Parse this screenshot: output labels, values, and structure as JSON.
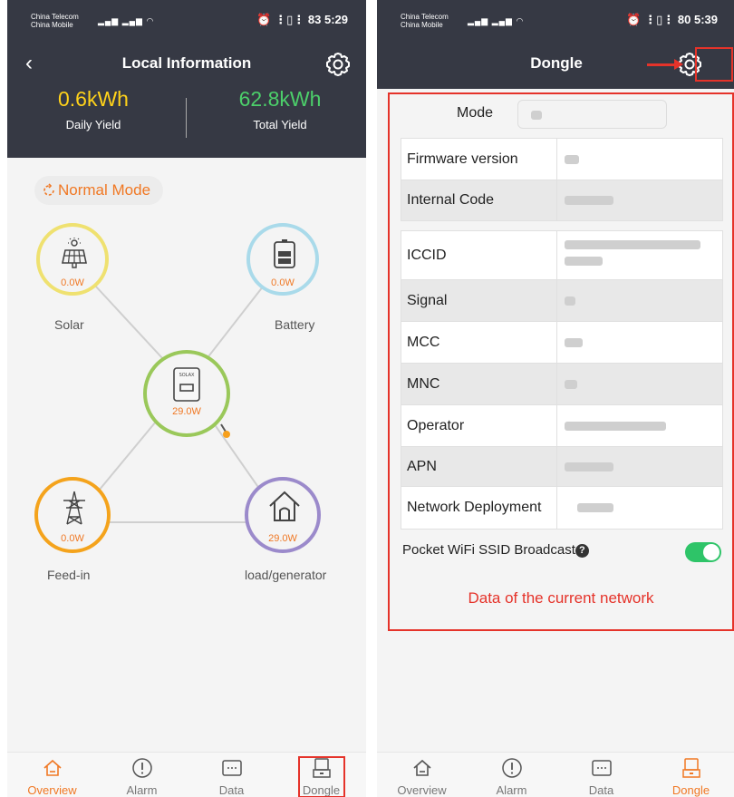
{
  "left": {
    "status": {
      "carrier1": "China Telecom",
      "carrier2": "China Mobile",
      "right": "⏰ ⋮▯⋮ 83 5:29"
    },
    "header": {
      "back": "‹",
      "title": "Local Information"
    },
    "yield": {
      "daily_value": "0.6kWh",
      "daily_label": "Daily Yield",
      "total_value": "62.8kWh",
      "total_label": "Total Yield"
    },
    "mode_label": "Normal Mode",
    "nodes": {
      "solar": {
        "power": "0.0W",
        "label": "Solar"
      },
      "battery": {
        "power": "0.0W",
        "label": "Battery"
      },
      "inverter": {
        "power": "29.0W"
      },
      "feedin": {
        "power": "0.0W",
        "label": "Feed-in"
      },
      "load": {
        "power": "29.0W",
        "label": "load/generator"
      }
    }
  },
  "right": {
    "status": {
      "carrier1": "China Telecom",
      "carrier2": "China Mobile",
      "right": "⏰ ⋮▯⋮ 80 5:39"
    },
    "header": {
      "title": "Dongle"
    },
    "mode_label": "Mode",
    "rows1": [
      {
        "label": "Firmware version"
      },
      {
        "label": "Internal Code"
      }
    ],
    "rows2": [
      {
        "label": "ICCID"
      },
      {
        "label": "Signal"
      },
      {
        "label": "MCC"
      },
      {
        "label": "MNC"
      },
      {
        "label": "Operator"
      },
      {
        "label": "APN"
      },
      {
        "label": "Network Deployment"
      }
    ],
    "wifi_label": "Pocket WiFi SSID Broadcast",
    "note": "Data of the current network"
  },
  "tabs": [
    "Overview",
    "Alarm",
    "Data",
    "Dongle"
  ],
  "colors": {
    "accent": "#f07824",
    "header": "#363944",
    "annotation": "#e5332a",
    "toggle": "#2ec468"
  },
  "icons": [
    "back-icon",
    "gear-icon",
    "refresh-icon",
    "solar-panel-icon",
    "battery-icon",
    "inverter-icon",
    "power-tower-icon",
    "house-icon",
    "home-tab-icon",
    "alarm-tab-icon",
    "data-tab-icon",
    "dongle-tab-icon",
    "question-icon",
    "toggle-icon"
  ]
}
